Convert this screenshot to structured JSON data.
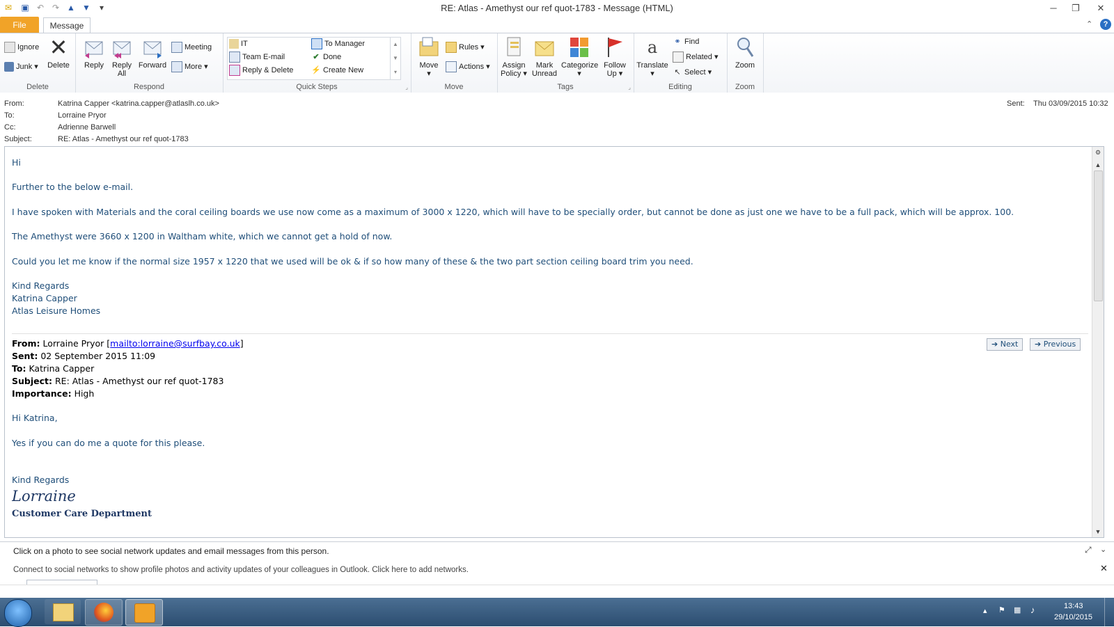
{
  "window": {
    "title": "RE: Atlas - Amethyst our ref quot-1783  -  Message (HTML)"
  },
  "tabs": {
    "file": "File",
    "message": "Message"
  },
  "ribbon": {
    "delete_group": {
      "label": "Delete",
      "ignore": "Ignore",
      "junk": "Junk",
      "delete": "Delete"
    },
    "respond_group": {
      "label": "Respond",
      "reply": "Reply",
      "reply_all_line1": "Reply",
      "reply_all_line2": "All",
      "forward": "Forward",
      "meeting": "Meeting",
      "more": "More"
    },
    "quicksteps_group": {
      "label": "Quick Steps",
      "items": [
        "IT",
        "Team E-mail",
        "Reply & Delete",
        "To Manager",
        "Done",
        "Create New"
      ]
    },
    "move_group": {
      "label": "Move",
      "move": "Move",
      "rules": "Rules",
      "actions": "Actions"
    },
    "tags_group": {
      "label": "Tags",
      "assign_line1": "Assign",
      "assign_line2": "Policy",
      "mark_line1": "Mark",
      "mark_line2": "Unread",
      "categorize": "Categorize",
      "follow_line1": "Follow",
      "follow_line2": "Up"
    },
    "editing_group": {
      "label": "Editing",
      "translate": "Translate",
      "find": "Find",
      "related": "Related",
      "select": "Select"
    },
    "zoom_group": {
      "label": "Zoom",
      "zoom": "Zoom"
    }
  },
  "header": {
    "from_label": "From:",
    "from_value": "Katrina Capper <katrina.capper@atlaslh.co.uk>",
    "to_label": "To:",
    "to_value": "Lorraine Pryor",
    "cc_label": "Cc:",
    "cc_value": "Adrienne Barwell",
    "subject_label": "Subject:",
    "subject_value": "RE: Atlas - Amethyst our ref quot-1783",
    "sent_label": "Sent:",
    "sent_value": "Thu 03/09/2015 10:32"
  },
  "body": {
    "greeting": "Hi",
    "line1": "Further to the below e-mail.",
    "line2": "I have spoken with Materials and the coral ceiling boards we use now come as a maximum of 3000 x 1220, which will have to be specially order, but cannot be done as just one we have to be a full pack, which will be approx. 100.",
    "line3": "The Amethyst were 3660 x 1200 in Waltham white, which we cannot get a hold of now.",
    "line4": "Could you let me know if the normal size 1957 x 1220 that we used will be ok & if so how many of these & the two part section ceiling board trim you need.",
    "sig1": "Kind Regards",
    "sig2": "Katrina Capper",
    "sig3": "Atlas Leisure Homes",
    "quoted": {
      "from_label": "From:",
      "from_name": "Lorraine Pryor [",
      "from_link": "mailto:lorraine@surfbay.co.uk",
      "from_close": "]",
      "sent_label": "Sent:",
      "sent_value": "02 September 2015 11:09",
      "to_label": "To:",
      "to_value": "Katrina Capper",
      "subject_label": "Subject:",
      "subject_value": "RE: Atlas - Amethyst our ref quot-1783",
      "importance_label": "Importance:",
      "importance_value": "High",
      "greeting": "Hi Katrina,",
      "line1": "Yes if you can do me a quote for this please.",
      "regards": "Kind Regards",
      "signature_name": "Lorraine",
      "signature_dept": "Customer Care Department"
    },
    "next_label": "Next",
    "previous_label": "Previous"
  },
  "people_pane": {
    "line1": "Click on a photo to see social network updates and email messages from this person.",
    "line2": "Connect to social networks to show profile photos and activity updates of your colleagues in Outlook. Click here to add networks."
  },
  "taskbar": {
    "time": "13:43",
    "date": "29/10/2015",
    "apps": [
      "start-orb-icon",
      "explorer-icon",
      "firefox-icon",
      "outlook-icon"
    ]
  },
  "colors": {
    "file_tab": "#f1a328",
    "body_text": "#1f4e79",
    "link": "#0000ee",
    "taskbar": "#2c4d70"
  }
}
